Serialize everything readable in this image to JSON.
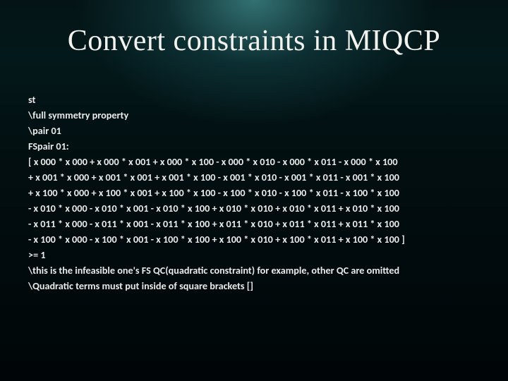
{
  "title": "Convert constraints in MIQCP",
  "lines": [
    "st",
    "\\full symmetry property",
    "\\pair 01",
    "FSpair 01:",
    "[ x 000 * x 000 + x 000 * x 001 + x 000 * x 100 - x 000 * x 010 - x 000 * x 011 - x 000 * x 100",
    " + x 001 * x 000 + x 001 * x 001 + x 001 * x 100 - x 001 * x 010 - x 001 * x 011 - x 001 * x 100",
    " + x 100 * x 000 + x 100 * x 001 + x 100 * x 100 - x 100 * x 010 - x 100 * x 011 - x 100 * x 100",
    " - x 010 * x 000 - x 010 * x 001 - x 010 * x 100 + x 010 * x 010 + x 010 * x 011 + x 010 * x 100",
    " - x 011 * x 000 - x 011 * x 001 - x 011 * x 100 + x 011 * x 010 + x 011 * x 011 + x 011 * x 100",
    " - x 100 * x 000 - x 100 * x 001 - x 100 * x 100 + x 100 * x 010 + x 100 * x 011 + x 100 * x 100 ]",
    ">= 1",
    "\\this is the infeasible one's FS QC(quadratic constraint) for example, other QC are omitted",
    "\\Quadratic terms must put inside of square brackets []"
  ]
}
